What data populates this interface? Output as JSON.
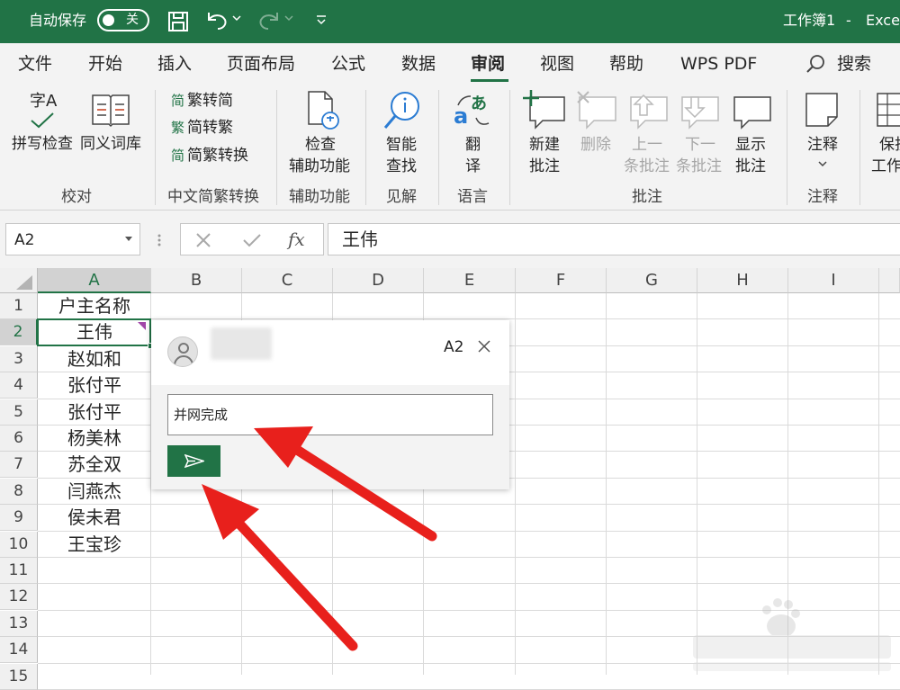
{
  "titlebar": {
    "autosave_label": "自动保存",
    "autosave_state": "关",
    "doc_title": "工作簿1",
    "separator": "-",
    "app_name": "Excel"
  },
  "tabs": [
    {
      "label": "文件"
    },
    {
      "label": "开始"
    },
    {
      "label": "插入"
    },
    {
      "label": "页面布局"
    },
    {
      "label": "公式"
    },
    {
      "label": "数据"
    },
    {
      "label": "审阅",
      "active": true
    },
    {
      "label": "视图"
    },
    {
      "label": "帮助"
    },
    {
      "label": "WPS PDF"
    }
  ],
  "search_label": "搜索",
  "ribbon": {
    "proofing": {
      "spell_icon_text": "字A",
      "spell_check": "拼写检查",
      "thesaurus": "同义词库",
      "group": "校对"
    },
    "chinese": {
      "trad_to_simp": "繁转简",
      "simp_to_trad": "简转繁",
      "convert": "简繁转换",
      "icon_simp": "简",
      "icon_trad": "繁",
      "icon_conv": "简",
      "group": "中文简繁转换"
    },
    "accessibility": {
      "line1": "检查",
      "line2": "辅助功能",
      "group": "辅助功能"
    },
    "insights": {
      "line1": "智能",
      "line2": "查找",
      "group": "见解"
    },
    "language": {
      "line1": "翻",
      "line2": "译",
      "group": "语言"
    },
    "comments": {
      "new_1": "新建",
      "new_2": "批注",
      "delete": "删除",
      "prev_1": "上一",
      "prev_2": "条批注",
      "next_1": "下一",
      "next_2": "条批注",
      "show_1": "显示",
      "show_2": "批注",
      "group": "批注"
    },
    "notes": {
      "line1": "注释",
      "group": "注释"
    },
    "protect": {
      "line1": "保护",
      "line2": "工作"
    }
  },
  "formula_bar": {
    "name_box": "A2",
    "fx": "fx",
    "content": "王伟"
  },
  "columns": [
    "A",
    "B",
    "C",
    "D",
    "E",
    "F",
    "G",
    "H",
    "I"
  ],
  "rows": [
    "1",
    "2",
    "3",
    "4",
    "5",
    "6",
    "7",
    "8",
    "9",
    "10",
    "11",
    "12",
    "13",
    "14",
    "15"
  ],
  "cells_a": [
    "户主名称",
    "王伟",
    "赵如和",
    "张付平",
    "张付平",
    "杨美林",
    "苏全双",
    "闫燕杰",
    "侯未君",
    "王宝珍"
  ],
  "comment": {
    "cell_ref": "A2",
    "text": "并网完成"
  },
  "colors": {
    "excel_green": "#217346",
    "arrow_red": "#e8201c",
    "comment_marker": "#a145a8"
  }
}
